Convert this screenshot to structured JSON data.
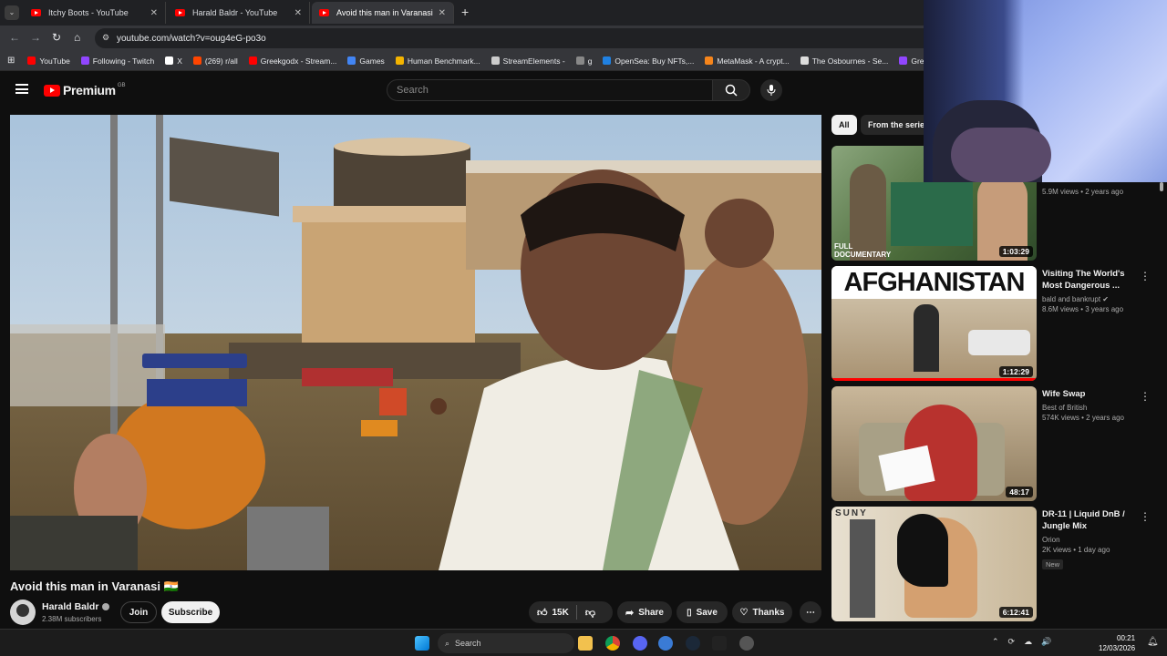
{
  "browser": {
    "tabs": [
      {
        "title": "Itchy Boots - YouTube"
      },
      {
        "title": "Harald Baldr - YouTube"
      },
      {
        "title": "Avoid this man in Varanasi"
      }
    ],
    "url": "youtube.com/watch?v=oug4eG-po3o",
    "bookmarks": [
      {
        "label": "YouTube",
        "color": "#ff0000"
      },
      {
        "label": "Following - Twitch",
        "color": "#9146ff"
      },
      {
        "label": "X",
        "color": "#ffffff"
      },
      {
        "label": "(269) r/all",
        "color": "#ff4500"
      },
      {
        "label": "Greekgodx - Stream...",
        "color": "#ff0000"
      },
      {
        "label": "Games",
        "color": "#4285f4"
      },
      {
        "label": "Human Benchmark...",
        "color": "#f4b400"
      },
      {
        "label": "StreamElements -",
        "color": "#cccccc"
      },
      {
        "label": "g",
        "color": "#888888"
      },
      {
        "label": "OpenSea: Buy NFTs,...",
        "color": "#2081e2"
      },
      {
        "label": "MetaMask - A crypt...",
        "color": "#f6851b"
      },
      {
        "label": "The Osbournes - Se...",
        "color": "#dddddd"
      },
      {
        "label": "Greek crack",
        "color": "#9146ff"
      }
    ]
  },
  "youtube": {
    "logo_text": "Premium",
    "region": "GB",
    "search_placeholder": "Search",
    "chips": [
      "All",
      "From the series"
    ],
    "video": {
      "title": "Avoid this man in Varanasi 🇮🇳",
      "channel": "Harald Baldr",
      "subscribers": "2.38M subscribers",
      "join": "Join",
      "subscribe": "Subscribe",
      "likes": "15K",
      "share": "Share",
      "save": "Save",
      "thanks": "Thanks"
    },
    "recommendations": [
      {
        "title": "",
        "channel": "",
        "meta": "5.9M views • 2 years ago",
        "duration": "1:03:29",
        "overlay": "FULL DOCUMENTARY",
        "color": "#4b6b3a"
      },
      {
        "title": "Visiting The World's Most Dangerous ...",
        "channel": "bald and bankrupt",
        "meta": "8.6M views • 3 years ago",
        "duration": "1:12:29",
        "overlay": "AFGHANISTAN",
        "color": "#a89272"
      },
      {
        "title": "Wife Swap",
        "channel": "Best of British",
        "meta": "574K views • 2 years ago",
        "duration": "48:17",
        "overlay": "",
        "color": "#b8322e"
      },
      {
        "title": "DR-11 | Liquid DnB / Jungle Mix",
        "channel": "Orion",
        "meta": "2K views • 1 day ago",
        "badge": "New",
        "duration": "6:12:41",
        "overlay": "SUNY",
        "color": "#c9b89a"
      }
    ]
  },
  "taskbar": {
    "search": "Search",
    "time": "00:21",
    "date": "12/03/2026"
  }
}
